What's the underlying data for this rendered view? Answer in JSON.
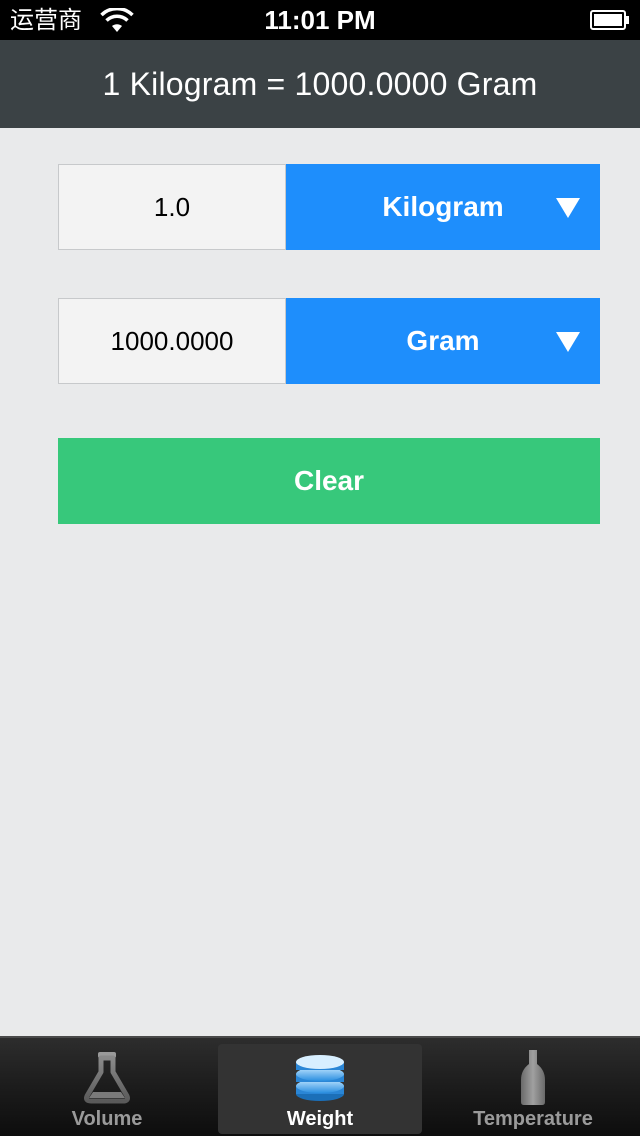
{
  "status_bar": {
    "carrier": "运营商",
    "time": "11:01 PM"
  },
  "header": {
    "title": "1 Kilogram = 1000.0000 Gram"
  },
  "converter": {
    "from": {
      "value": "1.0",
      "unit": "Kilogram"
    },
    "to": {
      "value": "1000.0000",
      "unit": "Gram"
    }
  },
  "clear_button": {
    "label": "Clear"
  },
  "tabs": [
    {
      "label": "Volume",
      "icon": "flask-icon",
      "selected": false
    },
    {
      "label": "Weight",
      "icon": "weight-stack-icon",
      "selected": true
    },
    {
      "label": "Temperature",
      "icon": "bottle-icon",
      "selected": false
    }
  ],
  "colors": {
    "header_bg": "#3b4245",
    "unit_select_bg": "#1e8efc",
    "clear_button_bg": "#37c87b",
    "page_bg": "#e9eaeb"
  }
}
